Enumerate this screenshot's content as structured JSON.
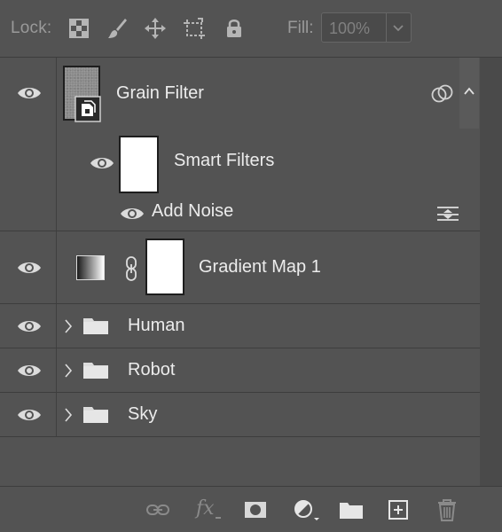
{
  "toolbar": {
    "lock_label": "Lock:",
    "lock_icons": [
      "lock-transparent-pixels-icon",
      "lock-image-pixels-icon",
      "lock-position-icon",
      "lock-artboard-icon",
      "lock-all-icon"
    ],
    "fill_label": "Fill:",
    "fill_value": "100%"
  },
  "layers": [
    {
      "name": "Grain Filter",
      "type": "smart-object",
      "visible": true,
      "expanded": true,
      "smart_filters": {
        "label": "Smart Filters",
        "filters": [
          {
            "name": "Add Noise"
          }
        ]
      }
    },
    {
      "name": "Gradient Map 1",
      "type": "adjustment",
      "visible": true
    },
    {
      "name": "Human",
      "type": "group",
      "visible": true,
      "expanded": false
    },
    {
      "name": "Robot",
      "type": "group",
      "visible": true,
      "expanded": false
    },
    {
      "name": "Sky",
      "type": "group",
      "visible": true,
      "expanded": false
    }
  ],
  "bottom_toolbar": {
    "fx_label": "fx",
    "icons": [
      "link-layers-icon",
      "layer-style-fx-icon",
      "add-mask-icon",
      "adjustment-layer-icon",
      "new-group-icon",
      "new-layer-icon",
      "delete-layer-icon"
    ]
  },
  "colors": {
    "panel_bg": "#535353",
    "text": "#ececec",
    "divider": "#3d3d3d"
  }
}
